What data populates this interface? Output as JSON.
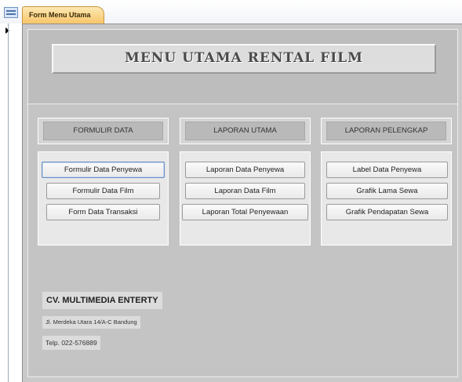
{
  "tab": {
    "title": "Form Menu Utama",
    "icon": "form-icon"
  },
  "record_selector": {
    "icon": "record-pointer-icon"
  },
  "header": {
    "title": "MENU UTAMA RENTAL FILM"
  },
  "columns": [
    {
      "header": "FORMULIR DATA",
      "buttons": [
        "Formulir Data Penyewa",
        "Formulir Data Film",
        "Form Data Transaksi"
      ]
    },
    {
      "header": "LAPORAN UTAMA",
      "buttons": [
        "Laporan Data Penyewa",
        "Laporan Data Film",
        "Laporan Total Penyewaan"
      ]
    },
    {
      "header": "LAPORAN PELENGKAP",
      "buttons": [
        "Label Data Penyewa",
        "Grafik Lama Sewa",
        "Grafik Pendapatan Sewa"
      ]
    }
  ],
  "company": {
    "name": "CV. MULTIMEDIA ENTERTY",
    "address": "Jl. Merdeka Utara 14/A-C Bandung",
    "phone": "Telp. 022-576889"
  },
  "colors": {
    "tab_accent": "#f7c66a",
    "form_background": "#c9c9c9",
    "panel_background": "#e8e8e8",
    "focus_border": "#6a8fc2"
  }
}
